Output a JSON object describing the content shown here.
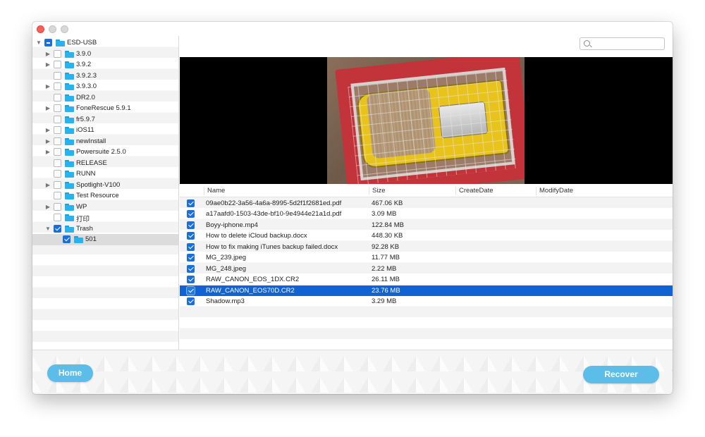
{
  "search": {
    "placeholder": ""
  },
  "tree": [
    {
      "label": "ESD-USB",
      "indent": 0,
      "expanded": true,
      "check": "mixed",
      "has_children": true
    },
    {
      "label": "3.9.0",
      "indent": 1,
      "check": "none",
      "has_children": true
    },
    {
      "label": "3.9.2",
      "indent": 1,
      "check": "none",
      "has_children": true
    },
    {
      "label": "3.9.2.3",
      "indent": 1,
      "check": "none",
      "has_children": false
    },
    {
      "label": "3.9.3.0",
      "indent": 1,
      "check": "none",
      "has_children": true
    },
    {
      "label": "DR2.0",
      "indent": 1,
      "check": "none",
      "has_children": false
    },
    {
      "label": "FoneRescue 5.9.1",
      "indent": 1,
      "check": "none",
      "has_children": true
    },
    {
      "label": "fr5.9.7",
      "indent": 1,
      "check": "none",
      "has_children": false
    },
    {
      "label": "iOS11",
      "indent": 1,
      "check": "none",
      "has_children": true
    },
    {
      "label": "newInstall",
      "indent": 1,
      "check": "none",
      "has_children": true
    },
    {
      "label": "Powersuite 2.5.0",
      "indent": 1,
      "check": "none",
      "has_children": true
    },
    {
      "label": "RELEASE",
      "indent": 1,
      "check": "none",
      "has_children": false
    },
    {
      "label": "RUNN",
      "indent": 1,
      "check": "none",
      "has_children": false
    },
    {
      "label": "Spotlight-V100",
      "indent": 1,
      "check": "none",
      "has_children": true
    },
    {
      "label": "Test Resource",
      "indent": 1,
      "check": "none",
      "has_children": false
    },
    {
      "label": "WP",
      "indent": 1,
      "check": "none",
      "has_children": true
    },
    {
      "label": "打印",
      "indent": 1,
      "check": "none",
      "has_children": false
    },
    {
      "label": "Trash",
      "indent": 1,
      "expanded": true,
      "check": "checked",
      "has_children": true
    },
    {
      "label": "501",
      "indent": 2,
      "check": "checked",
      "has_children": false,
      "selected": true
    }
  ],
  "table": {
    "columns": [
      "Name",
      "Size",
      "CreateDate",
      "ModifyDate"
    ],
    "rows": [
      {
        "name": "09ae0b22-3a56-4a6a-8995-5d2f1f2681ed.pdf",
        "size": "467.06 KB",
        "checked": true
      },
      {
        "name": "a17aafd0-1503-43de-bf10-9e4944e21a1d.pdf",
        "size": "3.09 MB",
        "checked": true
      },
      {
        "name": "Boyy-iphone.mp4",
        "size": "122.84 MB",
        "checked": true
      },
      {
        "name": "How to delete iCloud backup.docx",
        "size": "448.30 KB",
        "checked": true
      },
      {
        "name": "How to fix making iTunes backup failed.docx",
        "size": "92.28 KB",
        "checked": true
      },
      {
        "name": "MG_239.jpeg",
        "size": "11.77 MB",
        "checked": true
      },
      {
        "name": "MG_248.jpeg",
        "size": "2.22 MB",
        "checked": true
      },
      {
        "name": "RAW_CANON_EOS_1DX.CR2",
        "size": "26.11 MB",
        "checked": true
      },
      {
        "name": "RAW_CANON_EOS70D.CR2",
        "size": "23.76 MB",
        "checked": true,
        "selected": true
      },
      {
        "name": "Shadow.mp3",
        "size": "3.29 MB",
        "checked": true
      }
    ]
  },
  "buttons": {
    "home": "Home",
    "recover": "Recover"
  },
  "colors": {
    "accent": "#5bbde8",
    "selection": "#0f63d3",
    "folder": "#27b3ee",
    "checkbox": "#1b6fd8"
  }
}
